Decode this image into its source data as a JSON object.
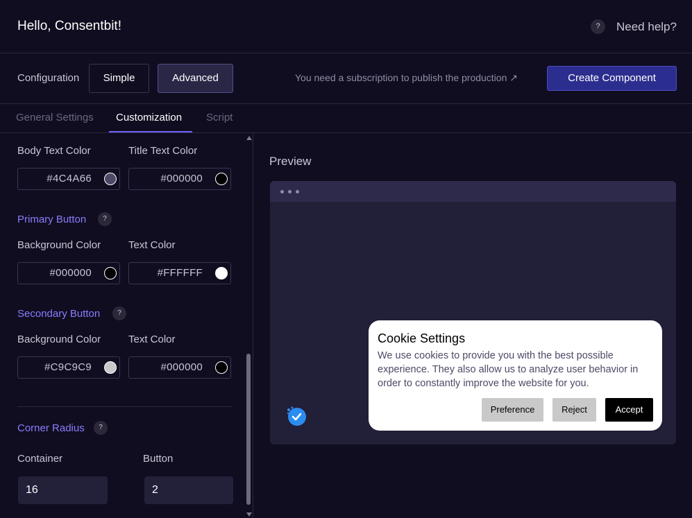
{
  "header": {
    "greeting": "Hello, Consentbit!",
    "help_icon": "question-icon",
    "help_label": "Need help?"
  },
  "config": {
    "label": "Configuration",
    "modes": [
      {
        "label": "Simple",
        "selected": false
      },
      {
        "label": "Advanced",
        "selected": true
      }
    ],
    "subscription_note": "You need a subscription to publish the production ↗",
    "create_button": "Create Component"
  },
  "tabs": [
    {
      "label": "General Settings",
      "active": false
    },
    {
      "label": "Customization",
      "active": true
    },
    {
      "label": "Script",
      "active": false
    }
  ],
  "text_colors": {
    "body_label": "Body Text Color",
    "body_value": "#4C4A66",
    "title_label": "Title Text Color",
    "title_value": "#000000"
  },
  "primary_button": {
    "title": "Primary Button",
    "bg_label": "Background Color",
    "bg_value": "#000000",
    "text_label": "Text Color",
    "text_value": "#FFFFFF"
  },
  "secondary_button": {
    "title": "Secondary Button",
    "bg_label": "Background Color",
    "bg_value": "#C9C9C9",
    "text_label": "Text Color",
    "text_value": "#000000"
  },
  "corner_radius": {
    "title": "Corner Radius",
    "container_label": "Container",
    "container_value": "16",
    "button_label": "Button",
    "button_value": "2"
  },
  "help_mark": "?",
  "preview": {
    "title": "Preview",
    "logo_icon": "consentbit-logo-icon",
    "cookie": {
      "title": "Cookie Settings",
      "body": "We use cookies to provide you with the best possible experience. They also allow us to analyze user behavior in order to constantly improve the website for you.",
      "preference": "Preference",
      "reject": "Reject",
      "accept": "Accept"
    }
  },
  "colors": {
    "accent": "#6f63ff",
    "create_button": "#2c2e8f",
    "background": "#0f0d1f"
  }
}
